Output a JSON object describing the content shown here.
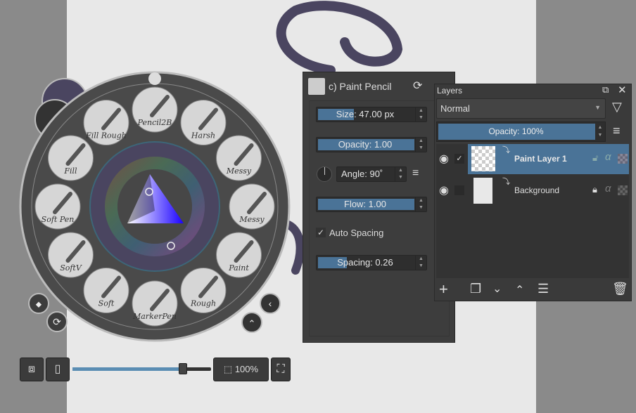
{
  "palette": {
    "brushes": [
      "Pencil2B",
      "Harsh",
      "Messy",
      "Messy",
      "Paint",
      "Rough",
      "MarkerPen",
      "Soft",
      "SoftV",
      "Soft Pen",
      "Fill",
      "Fill Rough"
    ],
    "foreground_color": "#4a4560",
    "accent": "#4a7397"
  },
  "brush_panel": {
    "title": "c) Paint Pencil",
    "size": "Size: 47.00 px",
    "size_fraction": 0.33,
    "opacity": "Opacity: 1.00",
    "opacity_fraction": 1.0,
    "angle": "Angle: 90˚",
    "flow": "Flow: 1.00",
    "flow_fraction": 1.0,
    "auto_spacing": "Auto Spacing",
    "auto_spacing_checked": true,
    "spacing": "Spacing: 0.26",
    "spacing_fraction": 0.26
  },
  "layers": {
    "title": "Layers",
    "blend_mode": "Normal",
    "opacity": "Opacity: 100%",
    "items": [
      {
        "name": "Paint Layer 1",
        "selected": true,
        "checked": true
      },
      {
        "name": "Background",
        "selected": false,
        "checked": false
      }
    ]
  },
  "bottom_bar": {
    "zoom": "100%",
    "zoom_slider_fraction": 0.8
  }
}
